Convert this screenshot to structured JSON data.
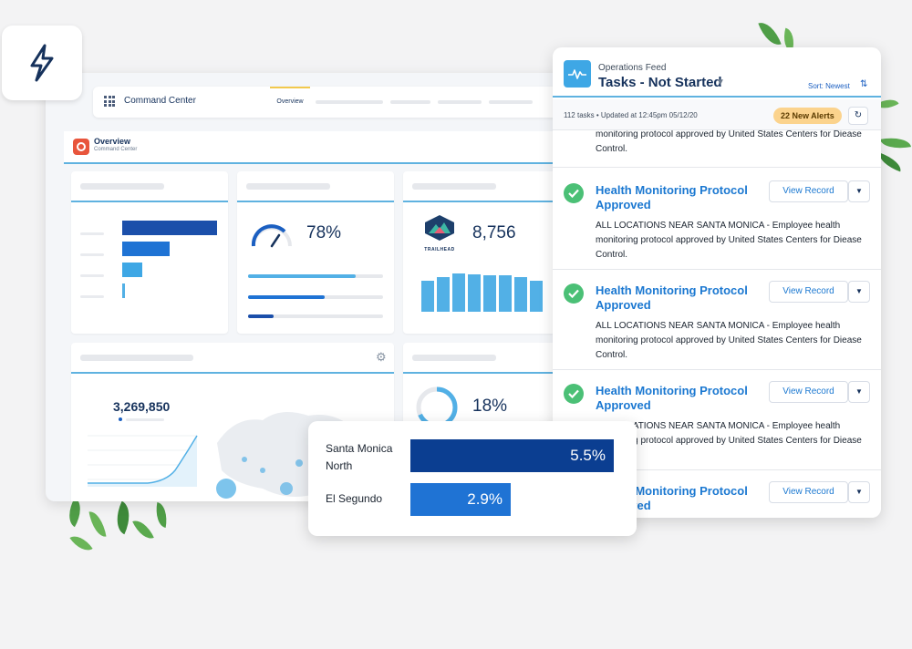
{
  "dashboard": {
    "app_name": "Command Center",
    "tab_active": "Overview",
    "overview_title": "Overview",
    "overview_subtitle": "Command Center",
    "gauge_percent": "78%",
    "trailhead_count": "8,756",
    "trailhead_logo_text": "TRAILHEAD",
    "total_count": "3,269,850",
    "ring_percent": "18%",
    "colors": {
      "accent": "#1b5fc1",
      "light_accent": "#52b0e6",
      "divider": "#5fb2e0"
    }
  },
  "feed": {
    "label": "Operations Feed",
    "title": "Tasks - Not Started",
    "sort_label": "Sort: Newest",
    "status_text": "112 tasks • Updated at 12:45pm 05/12/20",
    "alerts_badge": "22 New Alerts",
    "top_partial_text": "monitoring protocol approved by United States Centers for Diease Control.",
    "items": [
      {
        "title": "Health Monitoring Protocol Approved",
        "button": "View Record",
        "description": "ALL LOCATIONS NEAR SANTA MONICA - Employee health monitoring protocol approved by United States Centers for Diease Control."
      },
      {
        "title": "Health Monitoring Protocol Approved",
        "button": "View Record",
        "description": "ALL LOCATIONS NEAR SANTA MONICA - Employee health monitoring protocol approved by United States Centers for Diease Control."
      },
      {
        "title": "Health Monitoring Protocol Approved",
        "button": "View Record",
        "description": "ALL LOCATIONS NEAR SANTA MONICA - Employee health monitoring protocol approved by United States Centers for Diease Control."
      },
      {
        "title": "Health Monitoring Protocol Approved",
        "button": "View Record",
        "description": ""
      }
    ]
  },
  "locations": [
    {
      "name": "Santa Monica North",
      "value": "5.5%",
      "color": "#0b3e91"
    },
    {
      "name": "El Segundo",
      "value": "2.9%",
      "color": "#1f73d4"
    }
  ]
}
